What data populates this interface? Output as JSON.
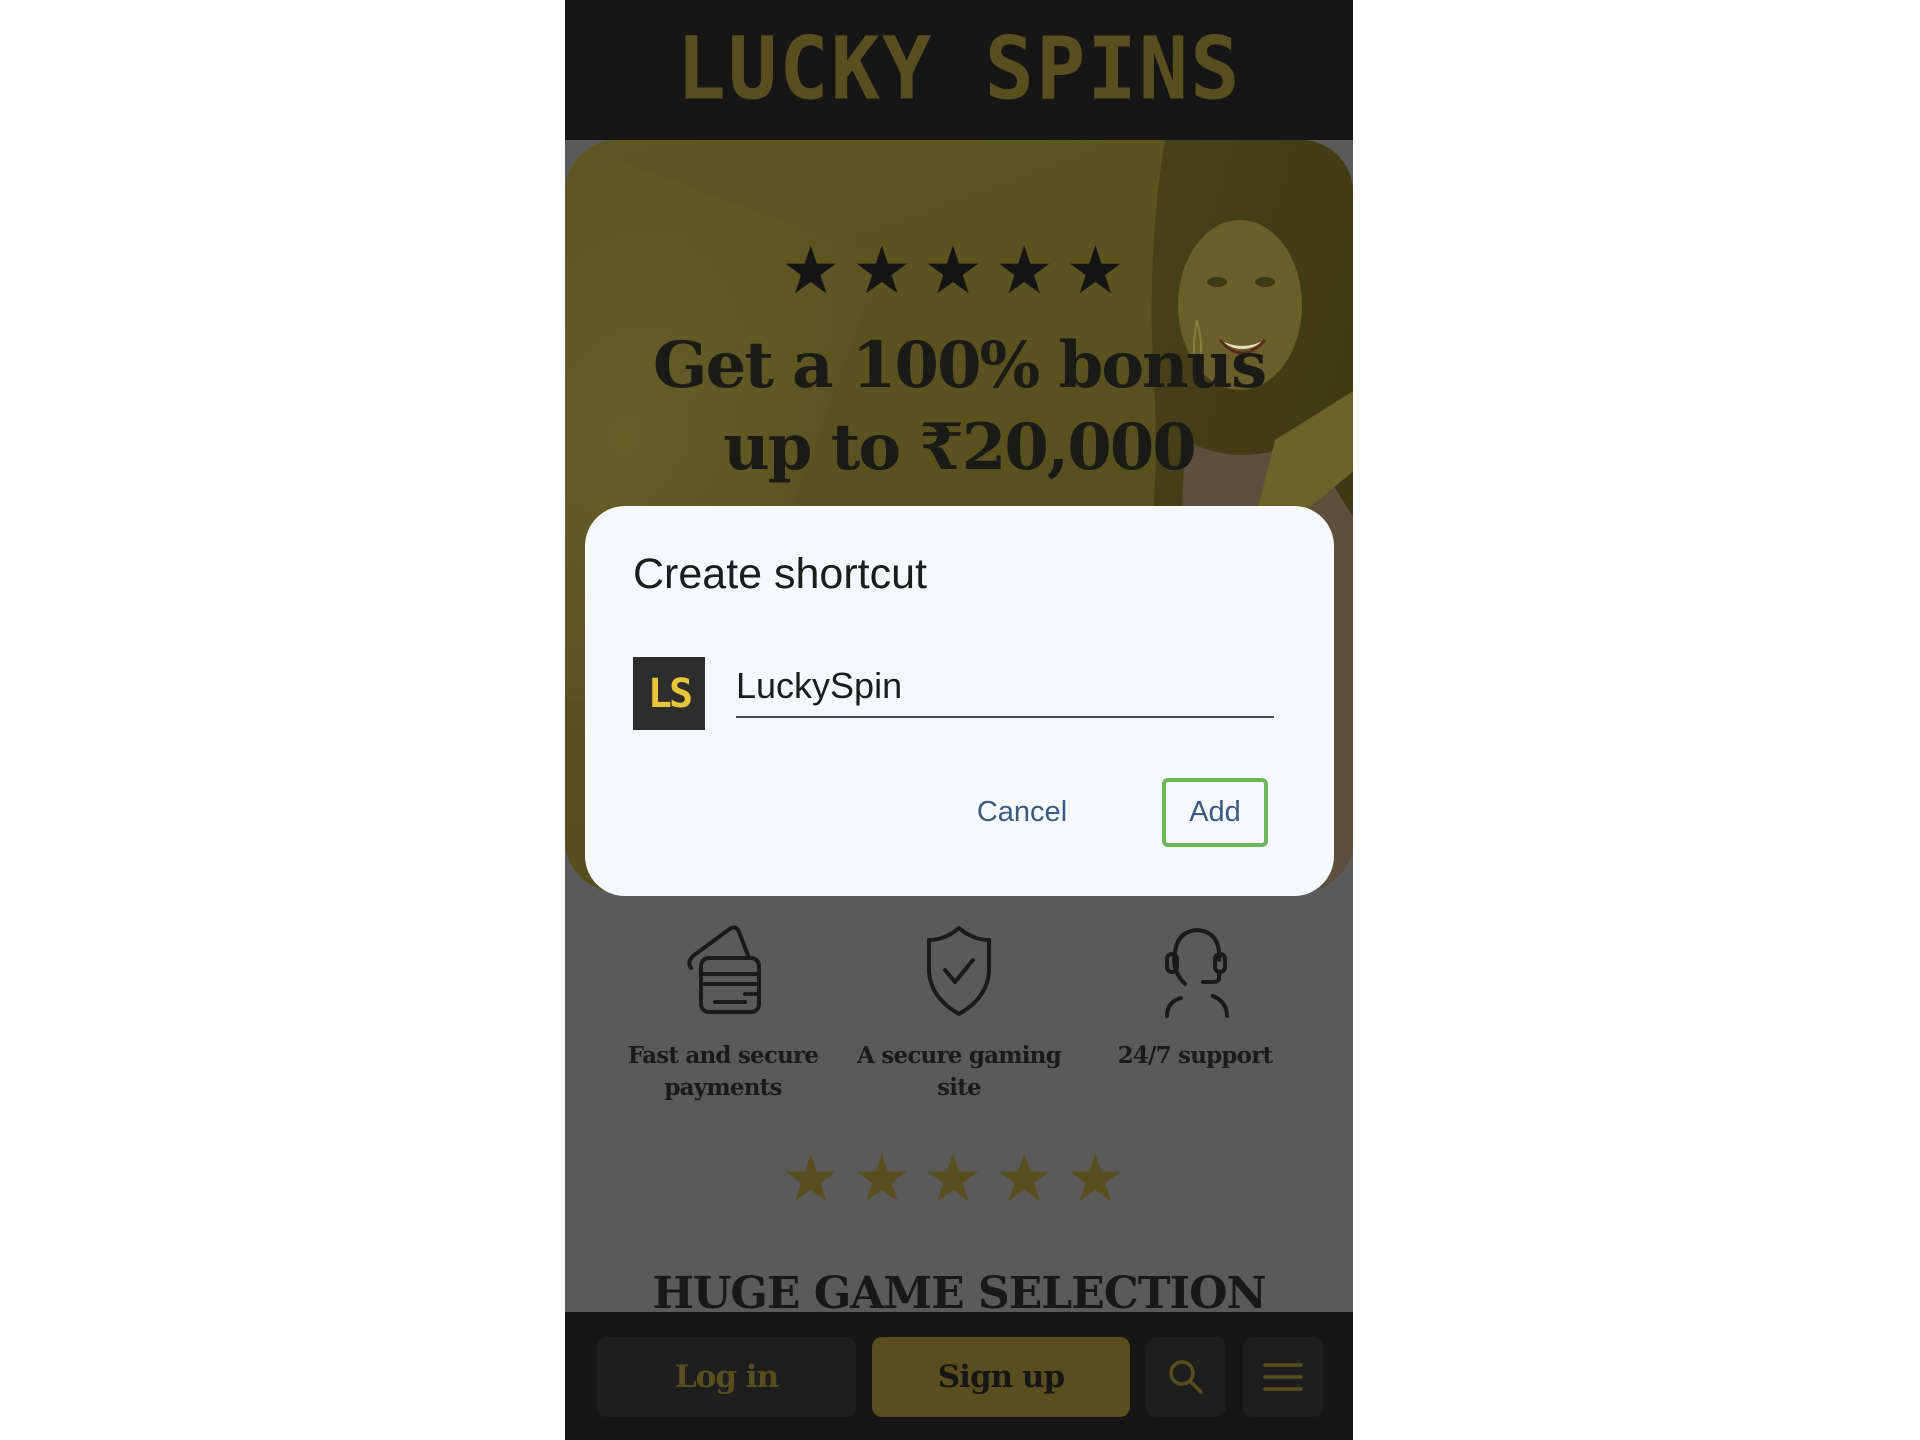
{
  "site": {
    "logo_text": "LUCKY SPINS",
    "brand_color": "#5b4e1e"
  },
  "banner": {
    "rating_stars": "★★★★★",
    "rating": 5,
    "headline_line1": "Get a 100% bonus",
    "headline_line2": "up to ₹20,000"
  },
  "features": [
    {
      "icon": "credit-card-icon",
      "label_line1": "Fast and secure",
      "label_line2": "payments"
    },
    {
      "icon": "shield-check-icon",
      "label_line1": "A secure gaming",
      "label_line2": "site"
    },
    {
      "icon": "headset-support-icon",
      "label_line1": "24/7 support",
      "label_line2": ""
    }
  ],
  "section": {
    "stars": "★★★★★",
    "heading": "HUGE GAME SELECTION"
  },
  "bottom_nav": {
    "login_label": "Log in",
    "signup_label": "Sign up",
    "search_icon": "search-icon",
    "menu_icon": "hamburger-menu-icon"
  },
  "dialog": {
    "title": "Create shortcut",
    "app_icon_text": "LS",
    "name_value": "LuckySpin",
    "cancel_label": "Cancel",
    "add_label": "Add",
    "focus_color": "#6db65a",
    "button_text_color": "#3c5a80"
  }
}
